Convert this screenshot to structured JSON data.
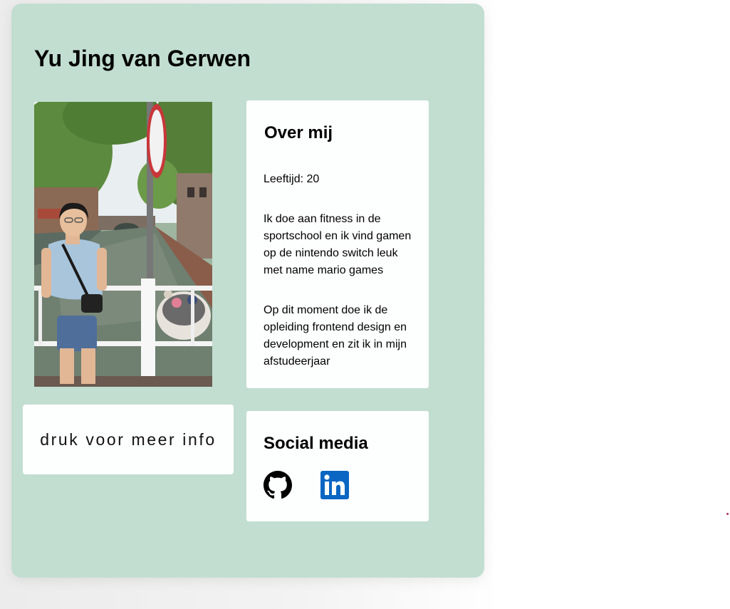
{
  "profile": {
    "name": "Yu Jing van Gerwen",
    "photo_icon": "profile-photo-canal"
  },
  "about": {
    "heading": "Over mij",
    "age": "Leeftijd: 20",
    "hobbies": "Ik doe aan fitness in de sportschool en ik vind gamen op de nintendo switch leuk met name mario games",
    "study": "Op dit moment doe ik de opleiding frontend design en development en zit ik in mijn afstudeerjaar"
  },
  "more_info": {
    "label": "druk voor meer info"
  },
  "social": {
    "heading": "Social media",
    "links": [
      {
        "icon": "github-icon"
      },
      {
        "icon": "linkedin-icon"
      }
    ]
  },
  "colors": {
    "card_background": "#c2ded1",
    "panel_background": "#fdfefe",
    "linkedin_blue": "#0a66c2"
  }
}
